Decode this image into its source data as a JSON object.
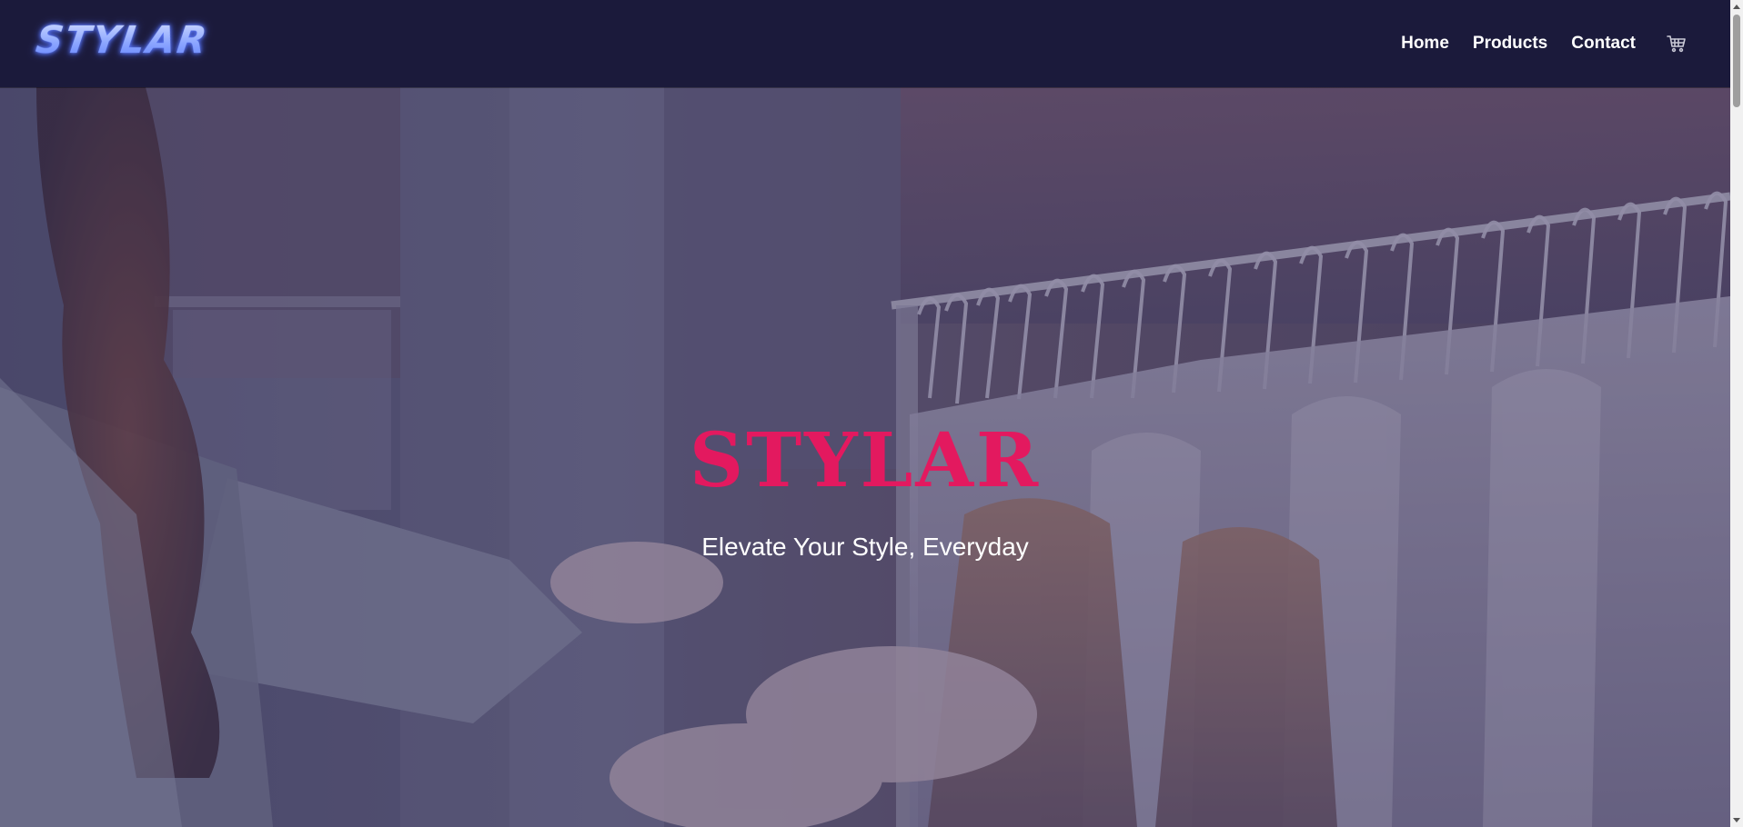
{
  "navbar": {
    "logo_text": "STYLAR",
    "links": [
      {
        "label": "Home"
      },
      {
        "label": "Products"
      },
      {
        "label": "Contact"
      }
    ],
    "cart_icon": "cart-icon"
  },
  "hero": {
    "title": "STYLAR",
    "tagline": "Elevate Your Style, Everyday",
    "background_description": "shopper browsing clothes on a rack of hangers"
  },
  "colors": {
    "navbar_bg": "#1b1a3b",
    "accent_pink": "#e3195f",
    "logo_blue": "#8ea8ff",
    "text_white": "#ffffff",
    "hero_overlay": "#28264f"
  }
}
